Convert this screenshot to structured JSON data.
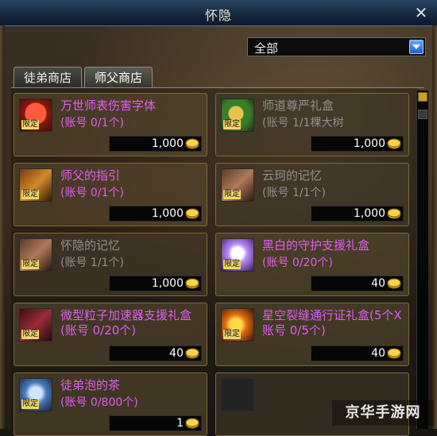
{
  "window": {
    "title": "怀隐"
  },
  "filter": {
    "selected": "全部"
  },
  "tabs": [
    {
      "label": "徒弟商店"
    },
    {
      "label": "师父商店"
    }
  ],
  "items": [
    {
      "name": "万世师表伤害字体",
      "limit": "(账号 0/1个)",
      "price": "1,000",
      "badge": "限定",
      "icon": "red-mushroom-icon"
    },
    {
      "name": "师道尊严礼盒",
      "limit": "(账号 1/1棵大树",
      "price": "1,000",
      "badge": "限定",
      "icon": "gold-gift-icon"
    },
    {
      "name": "师父的指引",
      "limit": "(账号 0/1个)",
      "price": "1,000",
      "badge": "限定",
      "icon": "gold-book-icon"
    },
    {
      "name": "云珂的记忆",
      "limit": "(账号 1/1个)",
      "price": "1,000",
      "badge": "限定",
      "icon": "brown-book-icon"
    },
    {
      "name": "怀隐的记忆",
      "limit": "(账号 1/1个)",
      "price": "1,000",
      "badge": "限定",
      "icon": "brown-book-icon"
    },
    {
      "name": "黑白的守护支援礼盒",
      "limit": "(账号 0/20个)",
      "price": "40",
      "badge": "限定",
      "icon": "white-sparkle-icon"
    },
    {
      "name": "微型粒子加速器支援礼盒(账号 0/20个)",
      "limit": "",
      "price": "40",
      "badge": "限定",
      "icon": "red-box-icon"
    },
    {
      "name": "星空裂缝通行证礼盒(5个X账号 0/5个)",
      "limit": "",
      "price": "40",
      "badge": "限定",
      "icon": "fire-claw-icon"
    },
    {
      "name": "徒弟泡的茶",
      "limit": "(账号 0/800个)",
      "price": "1",
      "badge": "限定",
      "icon": "tea-cup-icon"
    }
  ],
  "colors": {
    "purple_text": "#e15cf2",
    "grey_text": "#8f8f8f",
    "title_bar": "#16283d",
    "card_border": "#7a6a3a"
  },
  "watermark": "京华手游网"
}
